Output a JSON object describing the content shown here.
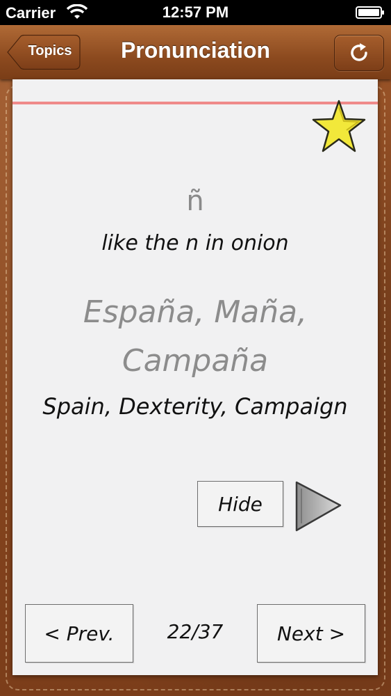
{
  "status_bar": {
    "carrier": "Carrier",
    "time": "12:57 PM"
  },
  "nav": {
    "title": "Pronunciation",
    "back_label": "Topics",
    "refresh_icon": "refresh-icon"
  },
  "card": {
    "letter": "ñ",
    "hint": "like the n in onion",
    "words": "España, Maña, Campaña",
    "translation": "Spain, Dexterity, Campaign",
    "hide_label": "Hide",
    "favorite_icon": "star-icon",
    "play_icon": "play-icon"
  },
  "pager": {
    "prev_label": "< Prev.",
    "next_label": "Next >",
    "counter": "22/37"
  },
  "colors": {
    "leather": "#8a4820",
    "paper": "#f1f1f2",
    "margin_line": "#ef8a8a",
    "star": "#f2e83a"
  }
}
